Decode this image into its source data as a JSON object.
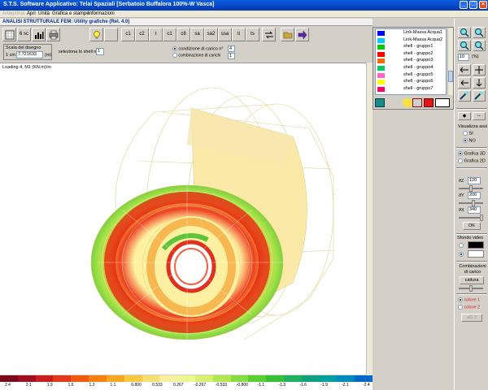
{
  "window": {
    "title": "S.T.S.  Software Applicativo:  Telai Spaziali   [Serbatoio Buffalora 100%-W Vasca]"
  },
  "menu": [
    "Anteprima",
    "Apri",
    "Unità",
    "Grafica e stampe",
    "Informazioni"
  ],
  "subtitle": "ANALISI STRUTTURALE FEM: Utility grafiche (Rel. 4.0)",
  "toolbar": {
    "labels": [
      "6 sc",
      "c1",
      "c2",
      "t",
      "c1",
      "c8",
      "sa",
      "sa2",
      "ssa",
      "ti",
      "ts"
    ]
  },
  "scale": {
    "label": "Scala del disegno",
    "cm_label": "1 cm =",
    "value": "7.721633",
    "unit": "(m)"
  },
  "shell": {
    "label": "seleziona lo shell n°",
    "value": "1"
  },
  "load": {
    "option1": "condizione di carico n°",
    "option2": "combinazione di carichi",
    "value1": "4",
    "value2": "1"
  },
  "canvas": {
    "loading_text": "Loading 4, M1 (KN.m)/m"
  },
  "legend_list": [
    {
      "name": "Link-Massa Acqua1",
      "color": "#0000ff"
    },
    {
      "name": "Link-Massa Acqua2",
      "color": "#00ccff"
    },
    {
      "name": "shell - gruppo1",
      "color": "#00cc00"
    },
    {
      "name": "shell - gruppo2",
      "color": "#ff0000"
    },
    {
      "name": "shell - gruppo3",
      "color": "#ff6600"
    },
    {
      "name": "shell - gruppo4",
      "color": "#00cc66"
    },
    {
      "name": "shell - gruppo5",
      "color": "#ff66cc"
    },
    {
      "name": "shell - gruppo6",
      "color": "#ffff00"
    },
    {
      "name": "shell - gruppo7",
      "color": "#ff0066"
    }
  ],
  "right_panel": {
    "zoom_value": "10",
    "zoom_unit": "(%)",
    "visual_axes_label": "Visualizza assi",
    "si_label": "SI",
    "no_label": "NO",
    "graphic3d": "Grafica 3D",
    "graphic2d": "Grafica 2D",
    "az_label": "ϑZ",
    "az_value": "120",
    "ay_label": "ϑY",
    "ay_value": "200",
    "ax_label": "ϑX",
    "ax_value": "340",
    "ok_label": "OK",
    "sfondo_label": "Sfondo video",
    "comb_label": "Combinazioni di carico",
    "cattura_label": "cattura",
    "color1_label": "colore 1",
    "color2_label": "colore 2",
    "add_label": "aG 3"
  },
  "colorbar": {
    "colors": [
      "#7a0a1a",
      "#9e1020",
      "#c81e1e",
      "#e03818",
      "#f05a10",
      "#f68010",
      "#f8a820",
      "#f8c840",
      "#f8e070",
      "#f8f0a0",
      "#eef890",
      "#d6f070",
      "#b0e850",
      "#86dc40",
      "#5ad030",
      "#36c038",
      "#20b060",
      "#10a080",
      "#00a0a0",
      "#0088c0",
      "#0068c8"
    ],
    "ticks": [
      "2.4",
      "2.1",
      "1.9",
      "1.6",
      "1.3",
      "1.1",
      "0.800",
      "0.533",
      "0.267",
      "-0.267",
      "-0.533",
      "-0.800",
      "-1.1",
      "-1.3",
      "-1.6",
      "-1.9",
      "-2.1",
      "-2.4"
    ]
  }
}
